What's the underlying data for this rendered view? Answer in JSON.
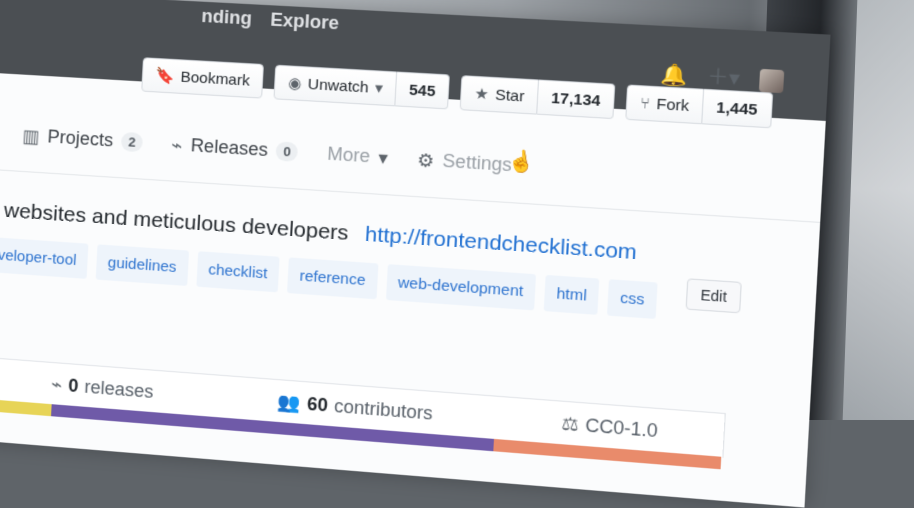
{
  "header": {
    "nav": [
      "nding",
      "Explore"
    ],
    "icons": [
      "bell-icon",
      "plus-icon",
      "avatar"
    ]
  },
  "repo_actions": {
    "bookmark": "Bookmark",
    "watch": "Unwatch",
    "watch_count": "545",
    "star": "Star",
    "star_count": "17,134",
    "fork": "Fork",
    "fork_count": "1,445"
  },
  "tabs": [
    {
      "label": "Projects",
      "count": "2"
    },
    {
      "label": "Releases",
      "count": "0"
    },
    {
      "label": "More"
    },
    {
      "label": "Settings"
    }
  ],
  "description": {
    "text": "n websites and meticulous developers",
    "link": "http://frontendchecklist.com",
    "edit": "Edit"
  },
  "topics": [
    "developer-tool",
    "guidelines",
    "checklist",
    "reference",
    "web-development",
    "html",
    "css"
  ],
  "stats": {
    "releases_count": "0",
    "releases_label": "releases",
    "contributors_count": "60",
    "contributors_label": "contributors",
    "license": "CC0-1.0"
  },
  "colors": {
    "topbar": "#4b4f53",
    "link": "#1f6fd1",
    "language_1": "#e7d457",
    "language_2": "#6f5aa8",
    "language_3": "#e98b6b"
  }
}
